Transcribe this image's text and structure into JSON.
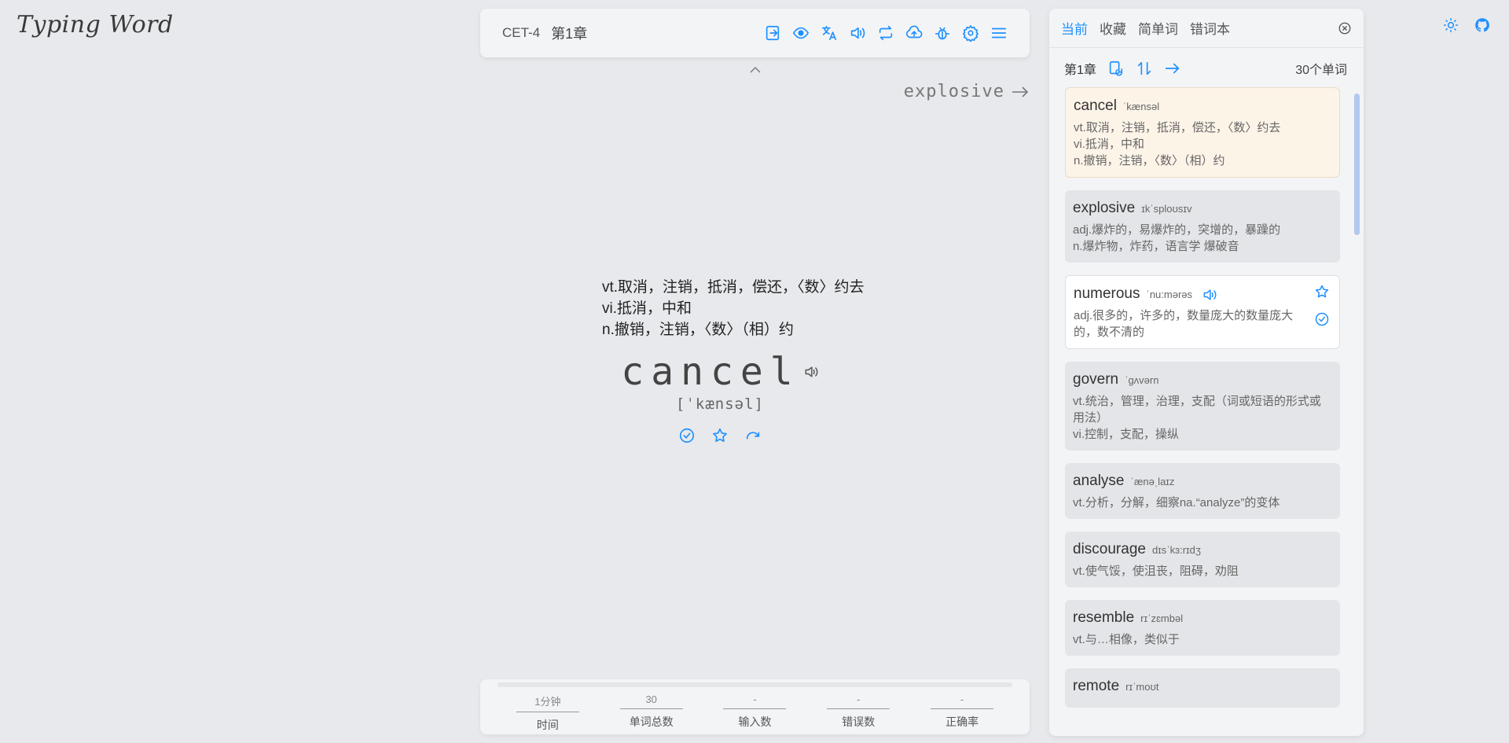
{
  "app": {
    "logo": "Typing Word"
  },
  "toolbar": {
    "dict": "CET-4",
    "chapter": "第1章",
    "icons": [
      "export-icon",
      "eye-icon",
      "translate-icon",
      "volume-icon",
      "repeat-icon",
      "cloud-upload-icon",
      "bug-icon",
      "settings-icon",
      "menu-icon"
    ]
  },
  "next_word": "explosive",
  "current": {
    "translations": [
      "vt.取消，注销，抵消，偿还，〈数〉约去",
      "vi.抵消，中和",
      "n.撤销，注销，〈数〉（相）约"
    ],
    "word": "cancel",
    "phonetic": "[ˈkænsəl]"
  },
  "stats": [
    {
      "value": "1分钟",
      "label": "时间"
    },
    {
      "value": "30",
      "label": "单词总数"
    },
    {
      "value": "-",
      "label": "输入数"
    },
    {
      "value": "-",
      "label": "错误数"
    },
    {
      "value": "-",
      "label": "正确率"
    }
  ],
  "panel": {
    "tabs": [
      "当前",
      "收藏",
      "简单词",
      "错词本"
    ],
    "active_tab": "当前",
    "chapter": "第1章",
    "count": "30个单词",
    "words": [
      {
        "word": "cancel",
        "phonetic": "ˈkænsəl",
        "trans": [
          "vt.取消，注销，抵消，偿还，〈数〉约去",
          "vi.抵消，中和",
          "n.撤销，注销，〈数〉（相）约"
        ]
      },
      {
        "word": "explosive",
        "phonetic": "ɪkˈsploʊsɪv",
        "trans": [
          "adj.爆炸的，易爆炸的，突增的，暴躁的",
          "n.爆炸物，炸药，语言学 爆破音"
        ]
      },
      {
        "word": "numerous",
        "phonetic": "ˈnu:mərəs",
        "trans": [
          "adj.很多的，许多的，数量庞大的数量庞大的，数不清的"
        ]
      },
      {
        "word": "govern",
        "phonetic": "ˈɡʌvərn",
        "trans": [
          "vt.统治，管理，治理，支配（词或短语的形式或用法）",
          "vi.控制，支配，操纵"
        ]
      },
      {
        "word": "analyse",
        "phonetic": "ˈænəˌlaɪz",
        "trans": [
          "vt.分析，分解，细察na.“analyze”的变体"
        ]
      },
      {
        "word": "discourage",
        "phonetic": "dɪsˈkɜ:rɪdʒ",
        "trans": [
          "vt.使气馁，使沮丧，阻碍，劝阻"
        ]
      },
      {
        "word": "resemble",
        "phonetic": "rɪˈzɛmbəl",
        "trans": [
          "vt.与…相像，类似于"
        ]
      },
      {
        "word": "remote",
        "phonetic": "rɪˈmoʊt",
        "trans": [
          ""
        ]
      }
    ]
  },
  "colors": {
    "accent": "#1e90ff",
    "active_card": "#fdf4e8",
    "background": "#e8e9ec"
  }
}
